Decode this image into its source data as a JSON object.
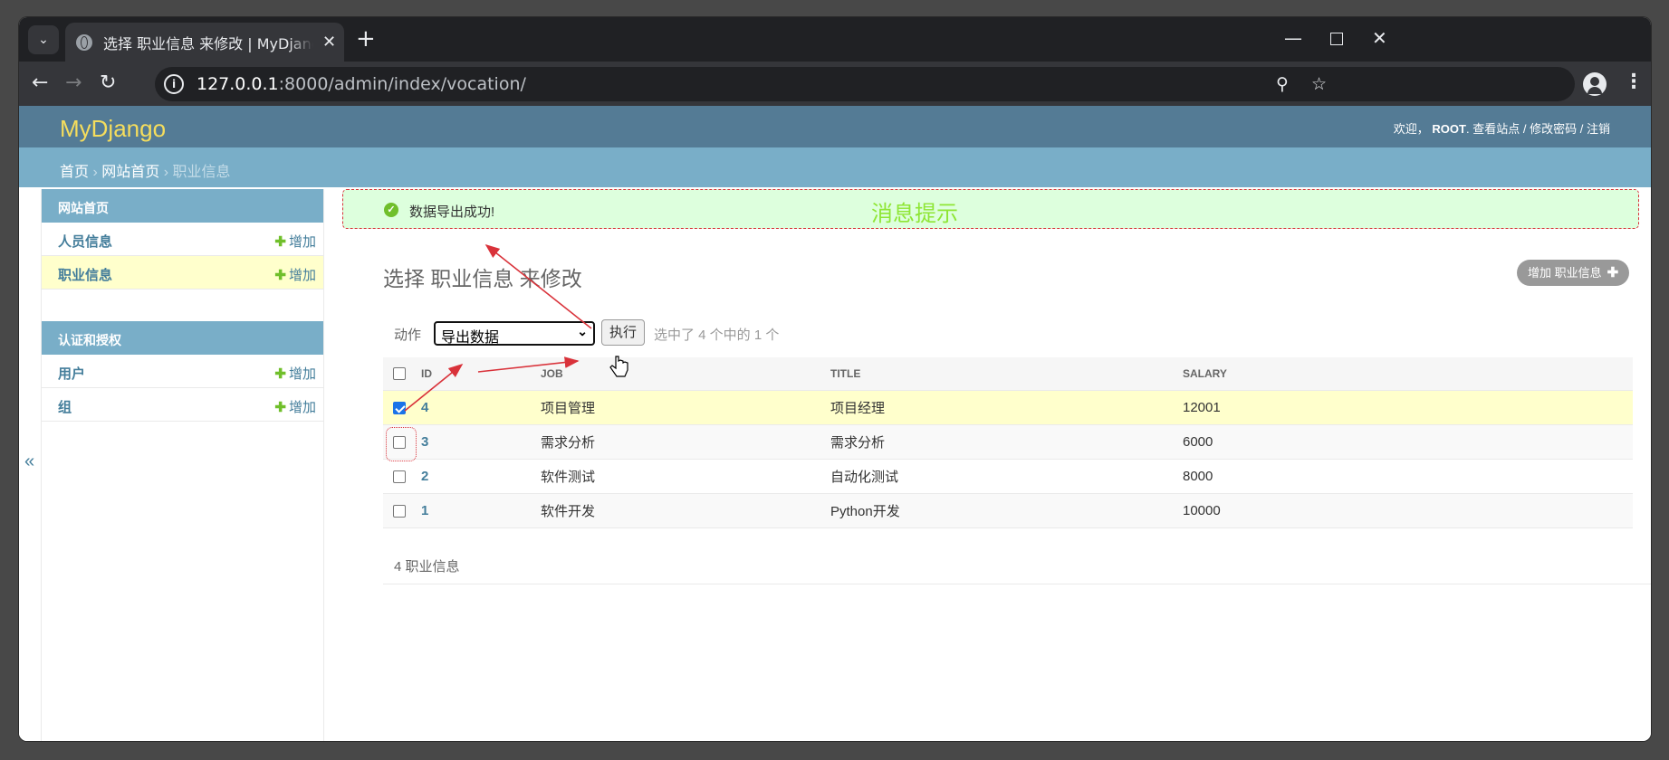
{
  "browser": {
    "tab_title": "选择 职业信息 来修改 | MyDjango",
    "url_host": "127.0.0.1",
    "url_path": ":8000/admin/index/vocation/"
  },
  "header": {
    "branding": "MyDjango",
    "welcome": "欢迎，",
    "username": "ROOT",
    "view_site": "查看站点",
    "change_password": "修改密码",
    "logout": "注销",
    "separator": "/"
  },
  "breadcrumbs": {
    "home": "首页",
    "app": "网站首页",
    "current": "职业信息",
    "sep": "›"
  },
  "nav_toggle": "«",
  "sidebar": {
    "modules": [
      {
        "caption": "网站首页",
        "models": [
          {
            "name": "人员信息",
            "add": "增加"
          },
          {
            "name": "职业信息",
            "add": "增加"
          }
        ]
      },
      {
        "caption": "认证和授权",
        "models": [
          {
            "name": "用户",
            "add": "增加"
          },
          {
            "name": "组",
            "add": "增加"
          }
        ]
      }
    ]
  },
  "message": {
    "text": "数据导出成功!",
    "annotation": "消息提示",
    "icon": "success-check-icon"
  },
  "content": {
    "title": "选择 职业信息 来修改",
    "add_button": "增加 职业信息",
    "action_label": "动作",
    "action_selected": "导出数据",
    "run_button": "执行",
    "selected_count": "选中了 4 个中的 1 个",
    "paginator": "4 职业信息"
  },
  "table": {
    "headers": [
      "ID",
      "JOB",
      "TITLE",
      "SALARY"
    ],
    "rows": [
      {
        "id": "4",
        "job": "项目管理",
        "title": "项目经理",
        "salary": "12001",
        "checked": true
      },
      {
        "id": "3",
        "job": "需求分析",
        "title": "需求分析",
        "salary": "6000",
        "checked": false
      },
      {
        "id": "2",
        "job": "软件测试",
        "title": "自动化测试",
        "salary": "8000",
        "checked": false
      },
      {
        "id": "1",
        "job": "软件开发",
        "title": "Python开发",
        "salary": "10000",
        "checked": false
      }
    ]
  },
  "colors": {
    "header_bg": "#547b95",
    "breadcrumb_bg": "#79aec8",
    "branding": "#f5dd5d",
    "link": "#447e9b",
    "selected_row": "#ffffcc",
    "success_bg": "#dddddd",
    "annotation_red": "#d9323a"
  }
}
